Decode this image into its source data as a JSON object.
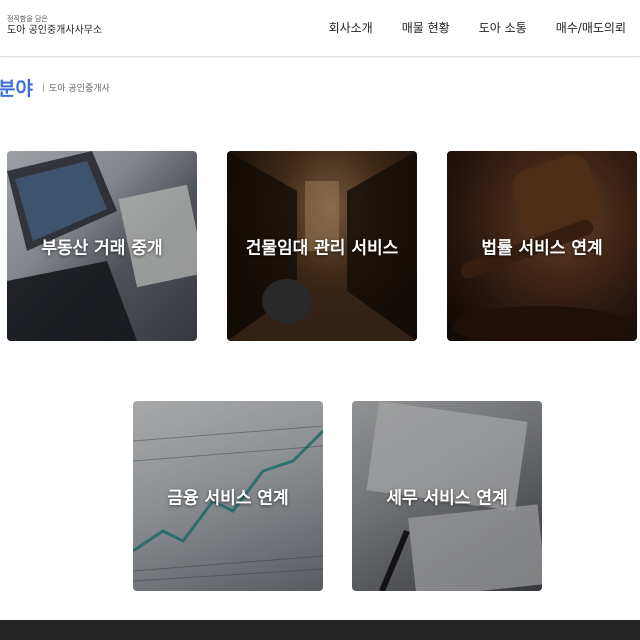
{
  "header": {
    "logo_tagline": "정직함을 담은",
    "logo_name": "도아 공인중개사사무소",
    "nav": [
      "회사소개",
      "매물 현황",
      "도아 소통",
      "매수/매도의뢰"
    ]
  },
  "section": {
    "title": "분야",
    "separator": "|",
    "subtitle": "도아 공인중개사"
  },
  "cards": [
    {
      "label": "부동산 거래 중개"
    },
    {
      "label": "건물임대 관리 서비스"
    },
    {
      "label": "법률 서비스 연계"
    },
    {
      "label": "금융 서비스 연계"
    },
    {
      "label": "세무 서비스 연계"
    }
  ],
  "colors": {
    "accent": "#3b6fd8",
    "footer": "#252525"
  }
}
